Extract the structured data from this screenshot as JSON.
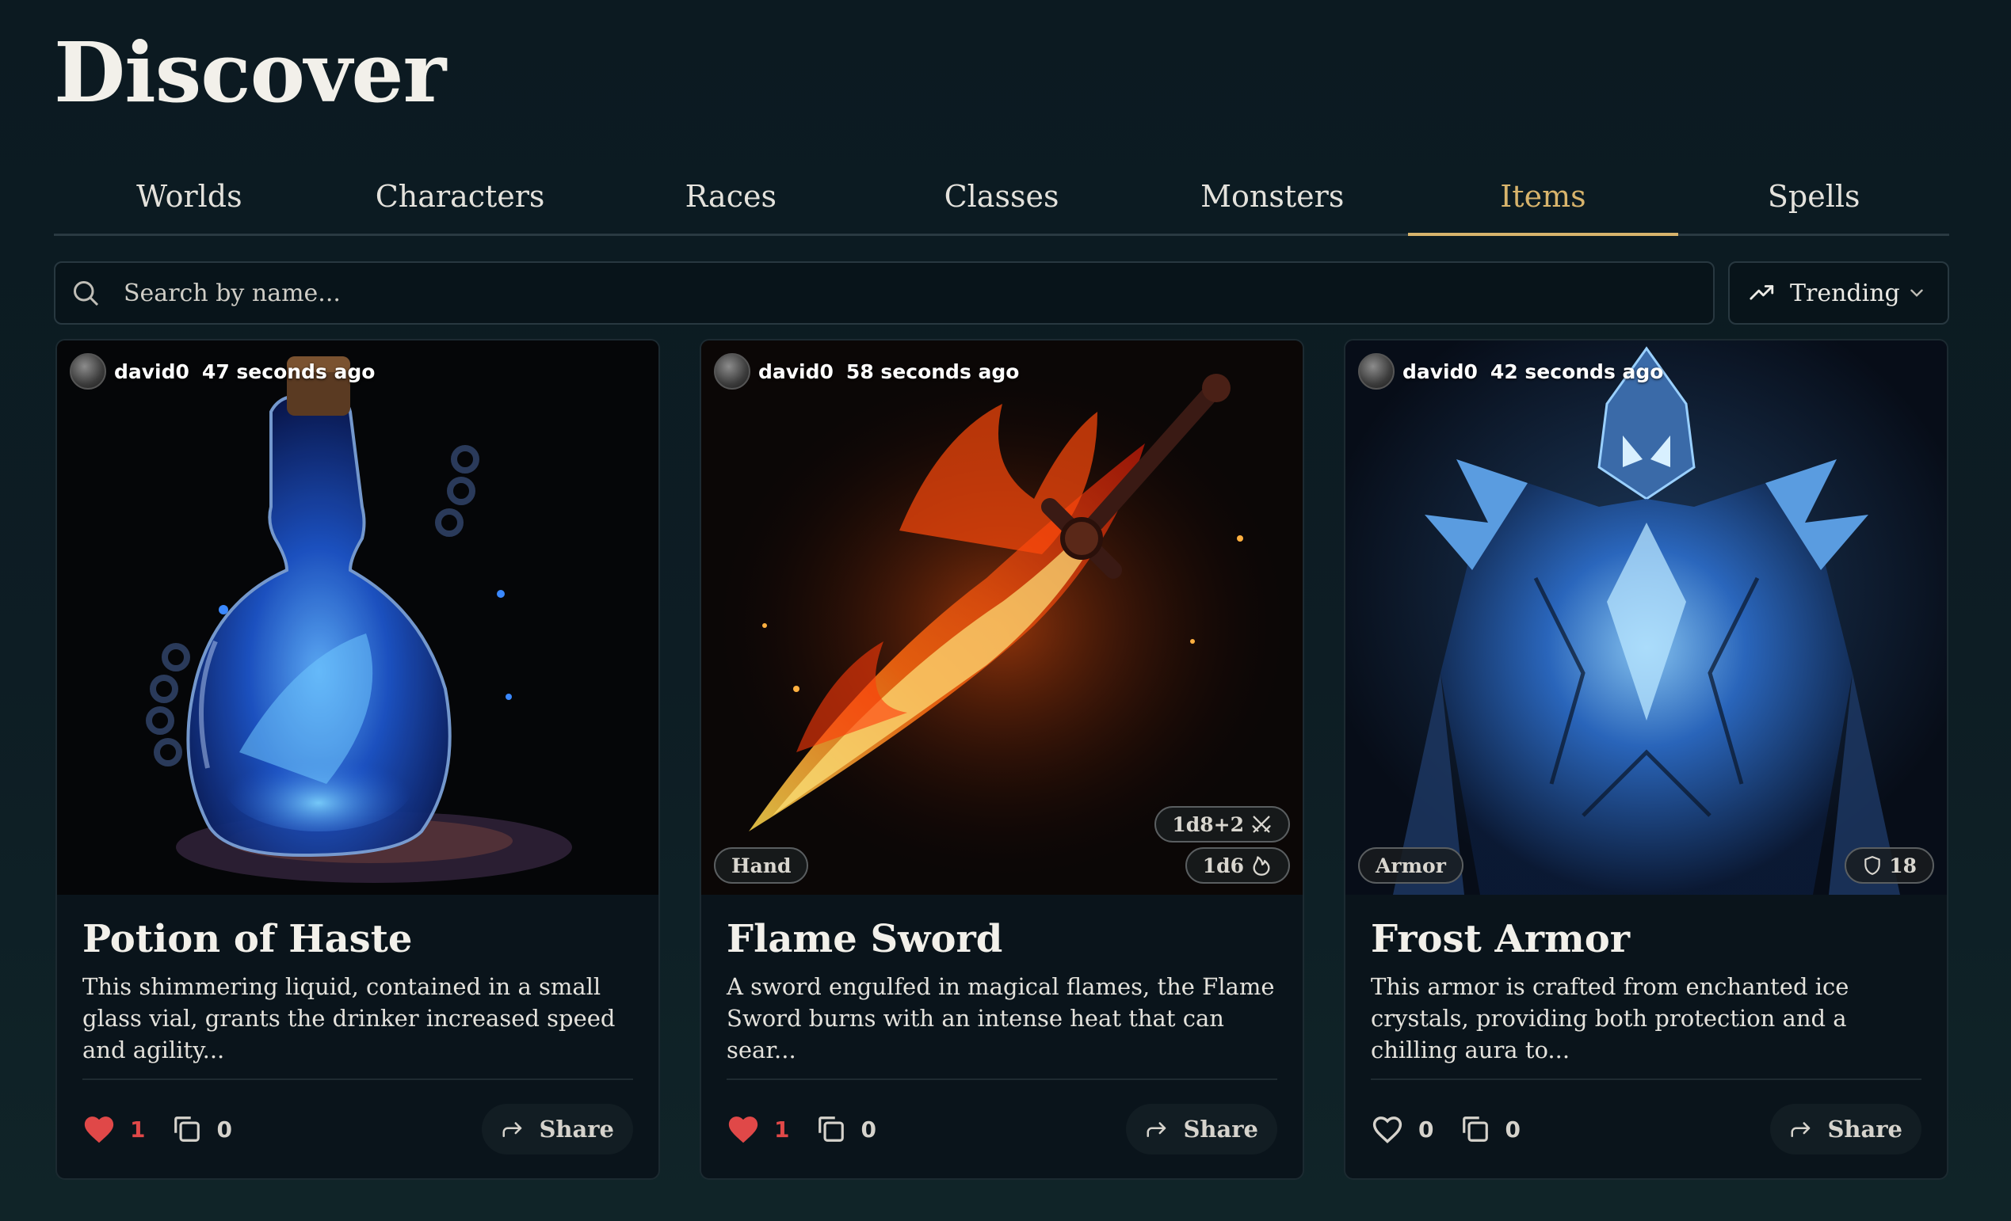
{
  "page": {
    "title": "Discover"
  },
  "tabs": [
    {
      "label": "Worlds",
      "active": false
    },
    {
      "label": "Characters",
      "active": false
    },
    {
      "label": "Races",
      "active": false
    },
    {
      "label": "Classes",
      "active": false
    },
    {
      "label": "Monsters",
      "active": false
    },
    {
      "label": "Items",
      "active": true
    },
    {
      "label": "Spells",
      "active": false
    }
  ],
  "search": {
    "placeholder": "Search by name...",
    "value": ""
  },
  "sort": {
    "label": "Trending",
    "icon": "trending-up-icon"
  },
  "colors": {
    "accent": "#d8b46c",
    "like": "#e04848",
    "background": "#0c1a21"
  },
  "cards": [
    {
      "author": "david0",
      "time": "47 seconds ago",
      "title": "Potion of Haste",
      "description": "This shimmering liquid, contained in a small glass vial, grants the drinker increased speed and agility...",
      "likes": "1",
      "liked": true,
      "copies": "0",
      "share_label": "Share",
      "image": "blue-potion-bottle"
    },
    {
      "author": "david0",
      "time": "58 seconds ago",
      "title": "Flame Sword",
      "description": "A sword engulfed in magical flames, the Flame Sword burns with an intense heat that can sear...",
      "likes": "1",
      "liked": true,
      "copies": "0",
      "share_label": "Share",
      "image": "flaming-sword",
      "type_badge": "Hand",
      "damage_badge": "1d8+2",
      "damage_icon": "crossed-swords-icon",
      "extra_badge": "1d6",
      "extra_icon": "fire-icon"
    },
    {
      "author": "david0",
      "time": "42 seconds ago",
      "title": "Frost Armor",
      "description": "This armor is crafted from enchanted ice crystals, providing both protection and a chilling aura to...",
      "likes": "0",
      "liked": false,
      "copies": "0",
      "share_label": "Share",
      "image": "ice-armor",
      "type_badge": "Armor",
      "ac_badge": "18",
      "ac_icon": "shield-icon"
    }
  ]
}
